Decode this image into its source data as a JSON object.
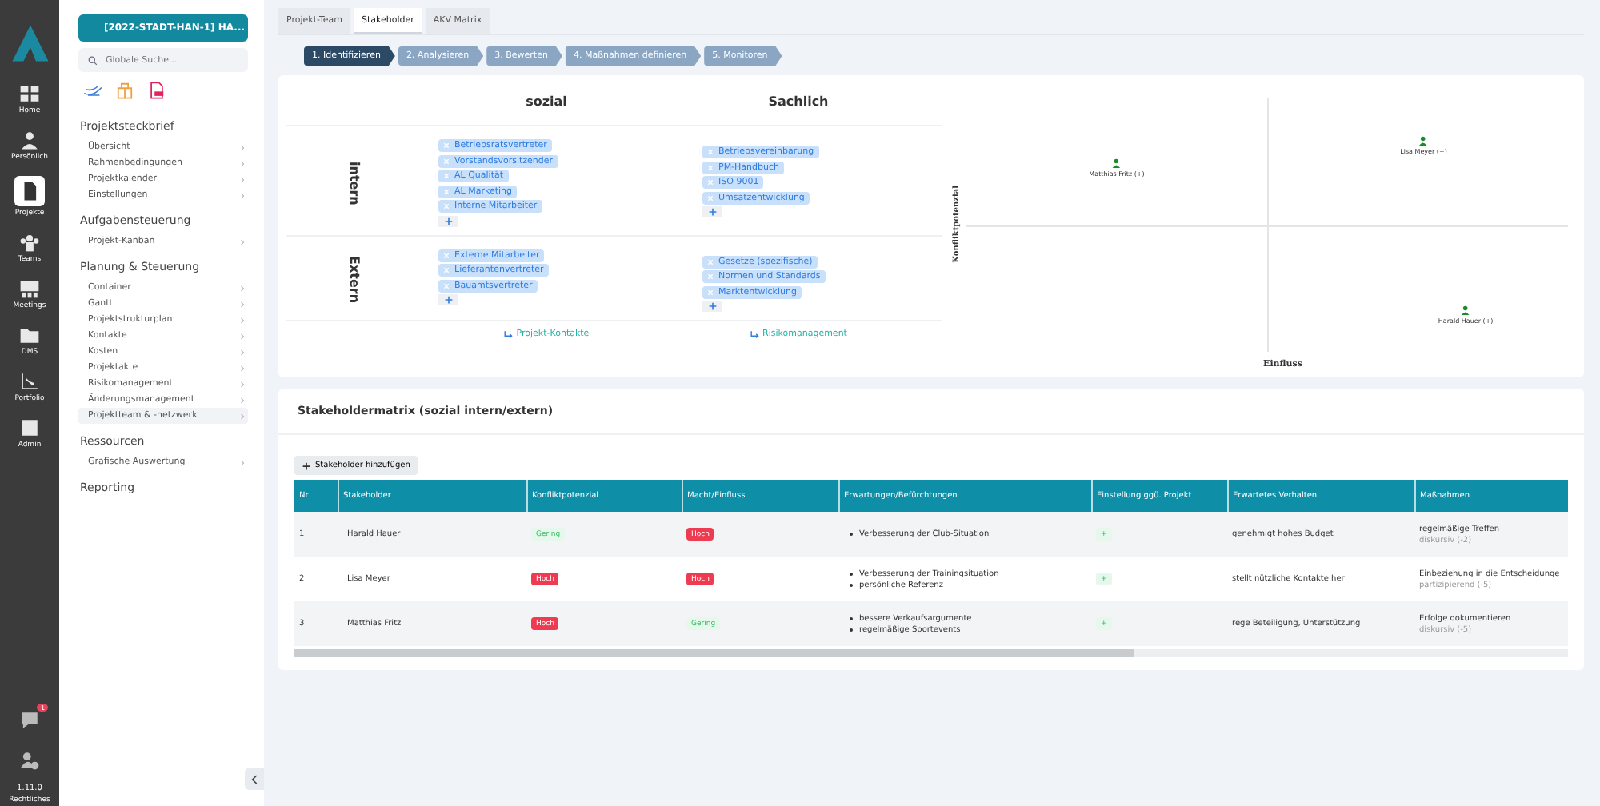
{
  "rail": {
    "items": [
      {
        "label": "Home",
        "selected": false
      },
      {
        "label": "Persönlich",
        "selected": false
      },
      {
        "label": "Projekte",
        "selected": true
      },
      {
        "label": "Teams",
        "selected": false
      },
      {
        "label": "Meetings",
        "selected": false
      },
      {
        "label": "DMS",
        "selected": false
      },
      {
        "label": "Portfolio",
        "selected": false
      },
      {
        "label": "Admin",
        "selected": false
      }
    ],
    "notification_badge": "1",
    "version": "1.11.0",
    "legal": "Rechtliches"
  },
  "sidebar": {
    "project_button": "[2022-STADT-HAN-1] HA...",
    "search": {
      "placeholder": "Globale Suche..."
    },
    "sections": [
      {
        "title": "Projektsteckbrief",
        "items": [
          {
            "label": "Übersicht",
            "selected": false
          },
          {
            "label": "Rahmenbedingungen",
            "selected": false
          },
          {
            "label": "Projektkalender",
            "selected": false
          },
          {
            "label": "Einstellungen",
            "selected": false
          }
        ]
      },
      {
        "title": "Aufgabensteuerung",
        "items": [
          {
            "label": "Projekt-Kanban",
            "selected": false
          }
        ]
      },
      {
        "title": "Planung & Steuerung",
        "items": [
          {
            "label": "Container",
            "selected": false
          },
          {
            "label": "Gantt",
            "selected": false
          },
          {
            "label": "Projektstrukturplan",
            "selected": false
          },
          {
            "label": "Kontakte",
            "selected": false
          },
          {
            "label": "Kosten",
            "selected": false
          },
          {
            "label": "Projektakte",
            "selected": false
          },
          {
            "label": "Risikomanagement",
            "selected": false
          },
          {
            "label": "Änderungsmanagement",
            "selected": false
          },
          {
            "label": "Projektteam & -netzwerk",
            "selected": true
          }
        ]
      },
      {
        "title": "Ressourcen",
        "items": [
          {
            "label": "Grafische Auswertung",
            "selected": false
          }
        ]
      },
      {
        "title": "Reporting"
      }
    ]
  },
  "tabs": [
    {
      "label": "Projekt-Team",
      "selected": false
    },
    {
      "label": "Stakeholder",
      "selected": true
    },
    {
      "label": "AKV Matrix",
      "selected": false
    }
  ],
  "steps": [
    {
      "label": "1. Identifizieren",
      "selected": true
    },
    {
      "label": "2. Analysieren",
      "selected": false
    },
    {
      "label": "3. Bewerten",
      "selected": false
    },
    {
      "label": "4. Maßnahmen definieren",
      "selected": false
    },
    {
      "label": "5. Monitoren",
      "selected": false
    }
  ],
  "stakeholder_grid": {
    "columns": [
      "sozial",
      "Sachlich"
    ],
    "rows": [
      {
        "label": "intern",
        "cells": [
          [
            "Betriebsratsvertreter",
            "Vorstandsvorsitzender",
            "AL Qualität",
            "AL Marketing",
            "Interne Mitarbeiter"
          ],
          [
            "Betriebsvereinbarung",
            "PM-Handbuch",
            "ISO 9001",
            "Umsatzentwicklung"
          ]
        ]
      },
      {
        "label": "Extern",
        "cells": [
          [
            "Externe Mitarbeiter",
            "Lieferantenvertreter",
            "Bauamtsvertreter"
          ],
          [
            "Gesetze (spezifische)",
            "Normen und Standards",
            "Marktentwicklung"
          ]
        ]
      }
    ],
    "links": [
      "Projekt-Kontakte",
      "Risikomanagement"
    ]
  },
  "chart": {
    "xlabel": "Einfluss",
    "ylabel": "Konfliktpotenzial",
    "points": [
      {
        "label": "Matthias Fritz (+)"
      },
      {
        "label": "Lisa Meyer (+)"
      },
      {
        "label": "Harald Hauer (+)"
      }
    ]
  },
  "matrix": {
    "title": "Stakeholdermatrix (sozial intern/extern)",
    "add_button": "Stakeholder hinzufügen",
    "columns": [
      "Nr",
      "Stakeholder",
      "Konfliktpotenzial",
      "Macht/Einfluss",
      "Erwartungen/Befürchtungen",
      "Einstellung ggü. Projekt",
      "Erwartetes Verhalten",
      "Maßnahmen"
    ],
    "rows": [
      {
        "nr": "1",
        "name": "Harald Hauer",
        "conflict": {
          "text": "Gering",
          "kind": "low"
        },
        "power": {
          "text": "Hoch",
          "kind": "high"
        },
        "expectations": [
          "Verbesserung der Club-Situation"
        ],
        "attitude": "+",
        "behavior": "genehmigt hohes Budget",
        "measure": "regelmäßige Treffen",
        "measure_note": "diskursiv (-2)"
      },
      {
        "nr": "2",
        "name": "Lisa Meyer",
        "conflict": {
          "text": "Hoch",
          "kind": "high"
        },
        "power": {
          "text": "Hoch",
          "kind": "high"
        },
        "expectations": [
          "Verbesserung der Trainingsituation",
          "persönliche Referenz"
        ],
        "attitude": "+",
        "behavior": "stellt nützliche Kontakte her",
        "measure": "Einbeziehung in die Entscheidunge",
        "measure_note": "partizipierend (-5)"
      },
      {
        "nr": "3",
        "name": "Matthias Fritz",
        "conflict": {
          "text": "Hoch",
          "kind": "high"
        },
        "power": {
          "text": "Gering",
          "kind": "low"
        },
        "expectations": [
          "bessere Verkaufsargumente",
          "regelmäßige Sportevents"
        ],
        "attitude": "+",
        "behavior": "rege Beteiligung, Unterstützung",
        "measure": "Erfolge dokumentieren",
        "measure_note": "diskursiv (-5)"
      }
    ]
  }
}
